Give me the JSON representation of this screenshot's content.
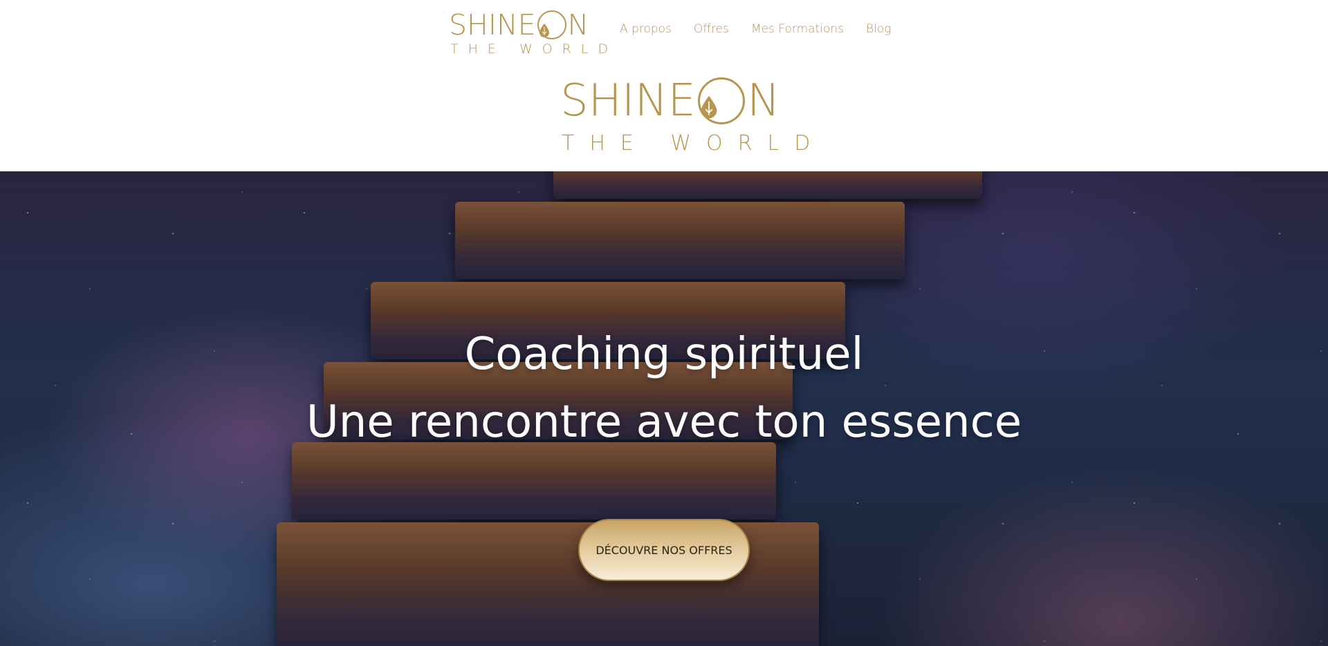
{
  "brand": {
    "logo_line1_prefix": "SHINE",
    "logo_ring_glyph": "💧",
    "logo_line1_suffix": "N",
    "logo_line2": "THE WORLD",
    "color": "#b8954f"
  },
  "nav": {
    "items": [
      {
        "label": "A propos"
      },
      {
        "label": "Offres"
      },
      {
        "label": "Mes Formations"
      },
      {
        "label": "Blog"
      }
    ]
  },
  "hero": {
    "title_line1": "Coaching spirituel",
    "title_line2": "Une rencontre avec ton essence",
    "cta_label": "DÉCOUVRE NOS OFFRES"
  }
}
